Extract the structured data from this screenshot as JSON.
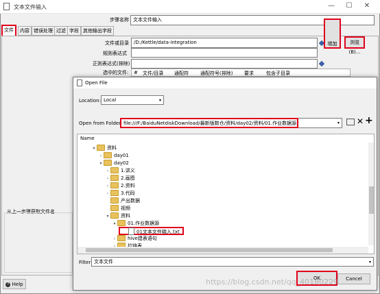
{
  "window": {
    "title": "文本文件输入",
    "minimize": "—",
    "maximize": "☐",
    "close": "✕"
  },
  "step_name": {
    "label": "步骤名称",
    "value": "文本文件输入"
  },
  "tabs": [
    "文件",
    "内容",
    "错误处理",
    "过滤",
    "字段",
    "其他输出字段"
  ],
  "file_form": {
    "file_or_dir_label": "文件或目录",
    "file_or_dir_value": "/D:/Kettle/data-integration",
    "regex_label": "规则表达式",
    "regex_exclude_label": "正则表达式(排除)",
    "selected_files_label": "选中的文件:",
    "add_button": "增加",
    "browse_button": "浏览(B)...",
    "table_headers": [
      "#",
      "文件/目录",
      "通配符",
      "通配符号(排除)",
      "要求",
      "包含子目录"
    ]
  },
  "prev_step_group": "从上一步骤获取文件名",
  "help_button": "Help",
  "open_file": {
    "title": "Open File",
    "location_label": "Location:",
    "location_value": "Local",
    "open_from_label": "Open from Folder:",
    "open_from_value": "file:///F:/BaiduNetdiskDownload/最新版数仓/资料/day02/资料/01.作业数据源",
    "name_header": "Name",
    "tree": [
      {
        "label": "资料",
        "indent": 2,
        "type": "folder",
        "arrow": "open"
      },
      {
        "label": "day01",
        "indent": 3,
        "type": "folder",
        "arrow": "closed"
      },
      {
        "label": "day02",
        "indent": 3,
        "type": "folder",
        "arrow": "open"
      },
      {
        "label": "1.讲义",
        "indent": 4,
        "type": "folder",
        "arrow": "closed"
      },
      {
        "label": "2.画图",
        "indent": 4,
        "type": "folder",
        "arrow": "closed"
      },
      {
        "label": "2.资料",
        "indent": 4,
        "type": "folder",
        "arrow": "closed"
      },
      {
        "label": "3.代码",
        "indent": 4,
        "type": "folder",
        "arrow": "closed"
      },
      {
        "label": "产出数据",
        "indent": 4,
        "type": "folder",
        "arrow": "none"
      },
      {
        "label": "视频",
        "indent": 4,
        "type": "folder",
        "arrow": "none"
      },
      {
        "label": "资料",
        "indent": 4,
        "type": "folder",
        "arrow": "open"
      },
      {
        "label": "01.作业数据源",
        "indent": 5,
        "type": "folder",
        "arrow": "open"
      },
      {
        "label": "01文本文件输入.txt",
        "indent": 6,
        "type": "file",
        "arrow": "none",
        "selected": true
      },
      {
        "label": "hive建表语句",
        "indent": 5,
        "type": "folder",
        "arrow": "closed"
      },
      {
        "label": "拉链表",
        "indent": 5,
        "type": "folder",
        "arrow": "closed"
      }
    ],
    "filter_label": "Filter:",
    "filter_value": "文本文件",
    "ok_button": "OK",
    "cancel_button": "Cancel"
  },
  "watermark": "https://blog.csdn.net/qq_40180229"
}
